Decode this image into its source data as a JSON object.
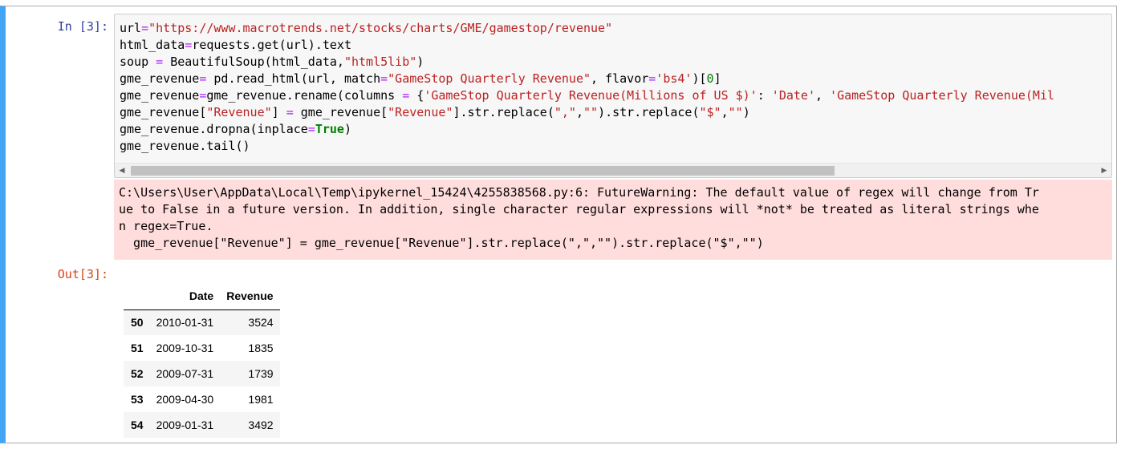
{
  "cell": {
    "in_prompt": "In [3]:",
    "out_prompt": "Out[3]:",
    "code_lines": [
      [
        {
          "t": "url"
        },
        {
          "t": "=",
          "c": "op"
        },
        {
          "t": "\"https://www.macrotrends.net/stocks/charts/GME/gamestop/revenue\"",
          "c": "str"
        }
      ],
      [
        {
          "t": "html_data"
        },
        {
          "t": "=",
          "c": "op"
        },
        {
          "t": "requests.get(url).text"
        }
      ],
      [
        {
          "t": "soup "
        },
        {
          "t": "=",
          "c": "op"
        },
        {
          "t": " BeautifulSoup(html_data,"
        },
        {
          "t": "\"html5lib\"",
          "c": "str"
        },
        {
          "t": ")"
        }
      ],
      [
        {
          "t": "gme_revenue"
        },
        {
          "t": "=",
          "c": "op"
        },
        {
          "t": " pd.read_html(url, match"
        },
        {
          "t": "=",
          "c": "op"
        },
        {
          "t": "\"GameStop Quarterly Revenue\"",
          "c": "str"
        },
        {
          "t": ", flavor"
        },
        {
          "t": "=",
          "c": "op"
        },
        {
          "t": "'bs4'",
          "c": "str"
        },
        {
          "t": ")["
        },
        {
          "t": "0",
          "c": "num"
        },
        {
          "t": "]"
        }
      ],
      [
        {
          "t": "gme_revenue"
        },
        {
          "t": "=",
          "c": "op"
        },
        {
          "t": "gme_revenue.rename(columns "
        },
        {
          "t": "=",
          "c": "op"
        },
        {
          "t": " {"
        },
        {
          "t": "'GameStop Quarterly Revenue(Millions of US $)'",
          "c": "str"
        },
        {
          "t": ": "
        },
        {
          "t": "'Date'",
          "c": "str"
        },
        {
          "t": ", "
        },
        {
          "t": "'GameStop Quarterly Revenue(Mil",
          "c": "str"
        }
      ],
      [
        {
          "t": "gme_revenue["
        },
        {
          "t": "\"Revenue\"",
          "c": "str"
        },
        {
          "t": "] "
        },
        {
          "t": "=",
          "c": "op"
        },
        {
          "t": " gme_revenue["
        },
        {
          "t": "\"Revenue\"",
          "c": "str"
        },
        {
          "t": "].str.replace("
        },
        {
          "t": "\",\"",
          "c": "str"
        },
        {
          "t": ","
        },
        {
          "t": "\"\"",
          "c": "str"
        },
        {
          "t": ").str.replace("
        },
        {
          "t": "\"$\"",
          "c": "str"
        },
        {
          "t": ","
        },
        {
          "t": "\"\"",
          "c": "str"
        },
        {
          "t": ")"
        }
      ],
      [
        {
          "t": "gme_revenue.dropna(inplace"
        },
        {
          "t": "=",
          "c": "op"
        },
        {
          "t": "True",
          "c": "kw"
        },
        {
          "t": ")"
        }
      ],
      [
        {
          "t": "gme_revenue.tail()"
        }
      ]
    ],
    "scroll": {
      "left_arrow": "◀",
      "right_arrow": "▶"
    },
    "stderr_lines": [
      "C:\\Users\\User\\AppData\\Local\\Temp\\ipykernel_15424\\4255838568.py:6: FutureWarning: The default value of regex will change from Tr",
      "ue to False in a future version. In addition, single character regular expressions will *not* be treated as literal strings whe",
      "n regex=True.",
      "  gme_revenue[\"Revenue\"] = gme_revenue[\"Revenue\"].str.replace(\",\",\"\").str.replace(\"$\",\"\")"
    ]
  },
  "dataframe": {
    "columns": [
      "",
      "Date",
      "Revenue"
    ],
    "rows": [
      {
        "index": "50",
        "date": "2010-01-31",
        "revenue": "3524"
      },
      {
        "index": "51",
        "date": "2009-10-31",
        "revenue": "1835"
      },
      {
        "index": "52",
        "date": "2009-07-31",
        "revenue": "1739"
      },
      {
        "index": "53",
        "date": "2009-04-30",
        "revenue": "1981"
      },
      {
        "index": "54",
        "date": "2009-01-31",
        "revenue": "3492"
      }
    ]
  },
  "colors": {
    "cell_selected_border": "#42a5f5",
    "in_prompt": "#303f9f",
    "out_prompt": "#d84315",
    "string": "#ba2121",
    "operator": "#aa22ff",
    "keyword": "#008000",
    "stderr_bg": "#ffdddd"
  }
}
